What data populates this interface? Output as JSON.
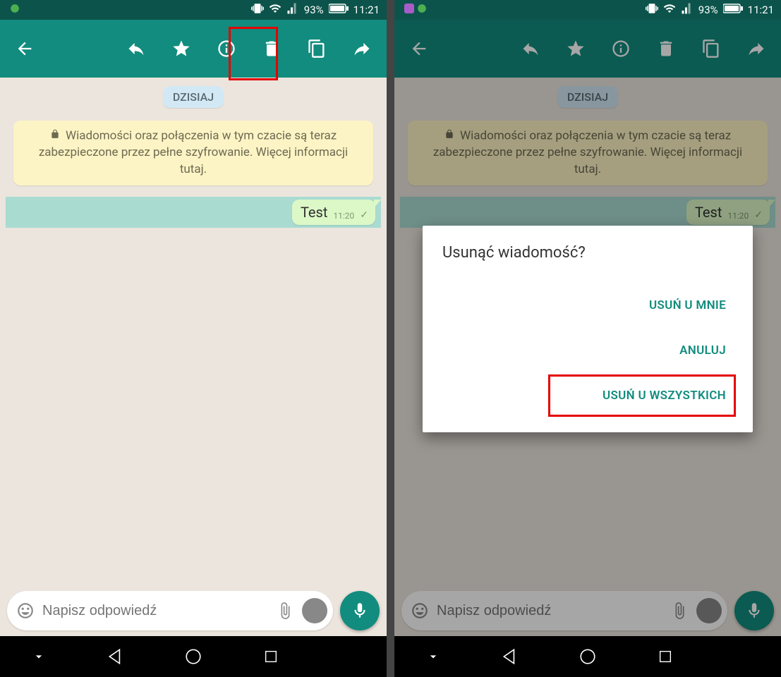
{
  "status": {
    "battery_pct": "93%",
    "time": "11:21"
  },
  "chat": {
    "date_label": "DZISIAJ",
    "encryption_notice": "Wiadomości oraz połączenia w tym czacie są teraz zabezpieczone przez pełne szyfrowanie. Więcej informacji tutaj.",
    "message_text": "Test",
    "message_time": "11:20"
  },
  "input": {
    "placeholder": "Napisz odpowiedź"
  },
  "dialog": {
    "title": "Usunąć wiadomość?",
    "delete_for_me": "USUŃ U MNIE",
    "cancel": "ANULUJ",
    "delete_for_everyone": "USUŃ U WSZYSTKICH"
  }
}
